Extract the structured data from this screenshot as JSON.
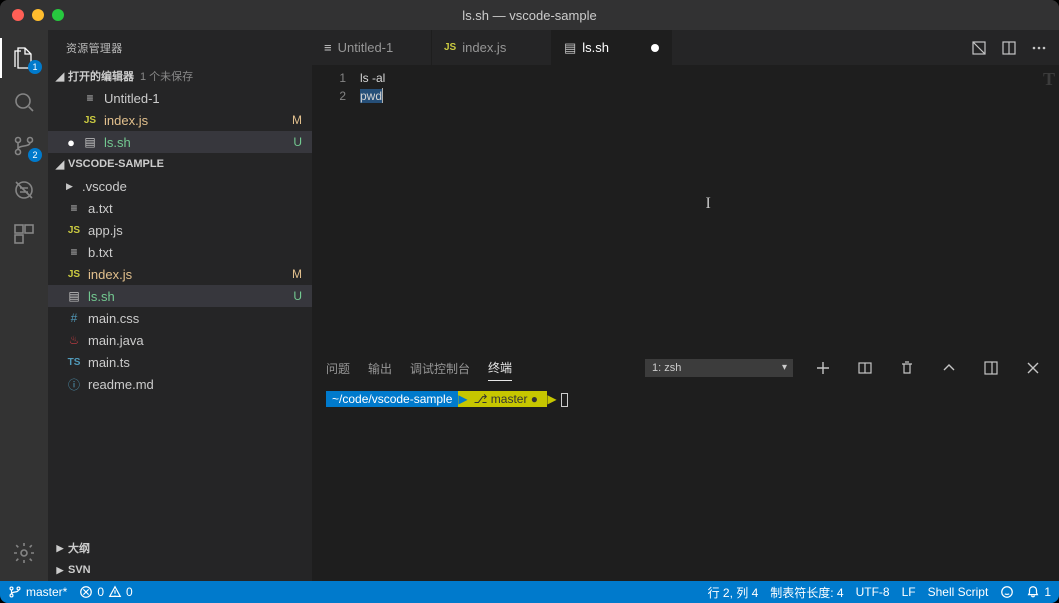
{
  "window": {
    "title": "ls.sh — vscode-sample"
  },
  "activitybar": {
    "explorer_badge": "1",
    "scm_badge": "2"
  },
  "sidebar": {
    "title": "资源管理器",
    "open_editors": {
      "label": "打开的编辑器",
      "unsaved": "1 个未保存",
      "items": [
        {
          "name": "Untitled-1",
          "icon": "file",
          "dirty": false,
          "status": ""
        },
        {
          "name": "index.js",
          "icon": "js",
          "dirty": false,
          "status": "M"
        },
        {
          "name": "ls.sh",
          "icon": "sh",
          "dirty": true,
          "status": "U"
        }
      ]
    },
    "workspace": {
      "label": "VSCODE-SAMPLE",
      "items": [
        {
          "name": ".vscode",
          "icon": "folder",
          "status": ""
        },
        {
          "name": "a.txt",
          "icon": "file",
          "status": ""
        },
        {
          "name": "app.js",
          "icon": "js",
          "status": ""
        },
        {
          "name": "b.txt",
          "icon": "file",
          "status": ""
        },
        {
          "name": "index.js",
          "icon": "js",
          "status": "M"
        },
        {
          "name": "ls.sh",
          "icon": "sh",
          "status": "U"
        },
        {
          "name": "main.css",
          "icon": "css",
          "status": ""
        },
        {
          "name": "main.java",
          "icon": "java",
          "status": ""
        },
        {
          "name": "main.ts",
          "icon": "ts",
          "status": ""
        },
        {
          "name": "readme.md",
          "icon": "md",
          "status": ""
        }
      ]
    },
    "outline": {
      "label": "大纲"
    },
    "svn": {
      "label": "SVN"
    }
  },
  "tabs": [
    {
      "name": "Untitled-1",
      "icon": "file",
      "active": false,
      "dirty": false
    },
    {
      "name": "index.js",
      "icon": "js",
      "active": false,
      "dirty": false
    },
    {
      "name": "ls.sh",
      "icon": "sh",
      "active": true,
      "dirty": true
    }
  ],
  "editor": {
    "lines": [
      {
        "num": "1",
        "text": "ls -al"
      },
      {
        "num": "2",
        "text_pre": "pw",
        "text_sel": "d"
      }
    ]
  },
  "panel": {
    "tabs": {
      "problems": "问题",
      "output": "输出",
      "debug": "调试控制台",
      "terminal": "终端"
    },
    "active": "terminal",
    "term_select": "1: zsh",
    "prompt_path": "~/code/vscode-sample",
    "prompt_branch": " master ● "
  },
  "statusbar": {
    "branch": "master*",
    "errors": "0",
    "warnings": "0",
    "cursor": "行 2,  列 4",
    "tabsize": "制表符长度: 4",
    "encoding": "UTF-8",
    "eol": "LF",
    "lang": "Shell Script",
    "notifications": "1"
  }
}
